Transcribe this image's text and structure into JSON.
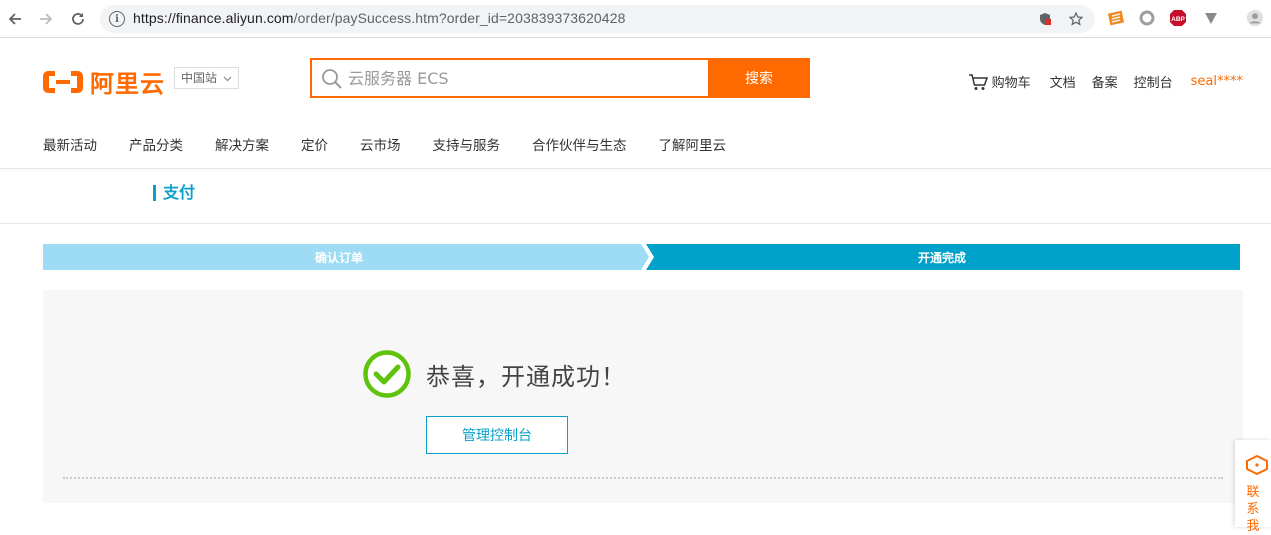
{
  "browser": {
    "url_host": "https://finance.aliyun.com",
    "url_path": "/order/paySuccess.htm?order_id=203839373620428",
    "extensions": [
      "bookmark-icon",
      "ext-orange-icon",
      "ext-circle-icon",
      "adblock-icon",
      "ext-v-icon",
      "profile-icon"
    ],
    "adblock_label": "ABP"
  },
  "header": {
    "logo_text": "阿里云",
    "region": "中国站",
    "search_placeholder": "云服务器 ECS",
    "search_button": "搜索",
    "links": {
      "cart": "购物车",
      "docs": "文档",
      "filing": "备案",
      "console": "控制台",
      "user": "seal****"
    },
    "nav": [
      "最新活动",
      "产品分类",
      "解决方案",
      "定价",
      "云市场",
      "支持与服务",
      "合作伙伴与生态",
      "了解阿里云"
    ]
  },
  "page": {
    "section_title": "支付",
    "steps": [
      "确认订单",
      "开通完成"
    ],
    "success_message": "恭喜，开通成功！",
    "console_button": "管理控制台"
  },
  "contact": {
    "label": "联系我"
  },
  "colors": {
    "brand": "#ff6a00",
    "step_done": "#9ddcf4",
    "step_active": "#00a2ca",
    "success_green": "#5ec30a"
  }
}
